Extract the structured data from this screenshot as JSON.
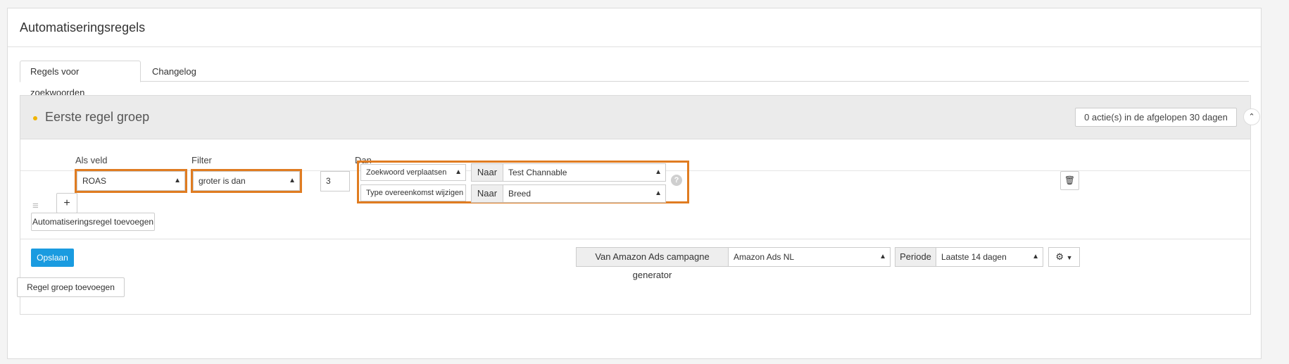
{
  "panel": {
    "title": "Automatiseringsregels"
  },
  "tabs": [
    {
      "label": "Regels voor zoekwoorden",
      "active": true
    },
    {
      "label": "Changelog",
      "active": false
    }
  ],
  "group": {
    "title": "Eerste regel groep",
    "actions_badge": "0 actie(s) in de afgelopen 30 dagen",
    "columns": {
      "field": "Als veld",
      "filter": "Filter",
      "then": "Dan"
    },
    "rule": {
      "field_value": "ROAS",
      "filter_value": "groter is dan",
      "number_value": "3",
      "actions": [
        {
          "action": "Zoekwoord verplaatsen",
          "to_label": "Naar",
          "to_value": "Test Channable"
        },
        {
          "action": "Type overeenkomst wijzigen",
          "to_label": "Naar",
          "to_value": "Breed"
        }
      ]
    },
    "add_rule_label": "Automatiseringsregel toevoegen",
    "save_label": "Opslaan",
    "source_label": "Van Amazon Ads campagne generator",
    "source_value": "Amazon Ads NL",
    "period_label": "Periode",
    "period_value": "Laatste 14 dagen"
  },
  "add_group_label": "Regel groep toevoegen",
  "colors": {
    "accent": "#1a9be0",
    "highlight": "#e07c21",
    "dot": "#f0b400"
  },
  "icons": [
    "drag-handle-icon",
    "plus-icon",
    "select-arrows-icon",
    "help-icon",
    "trash-icon",
    "gear-icon",
    "chevron-up-icon",
    "caret-down-icon"
  ]
}
